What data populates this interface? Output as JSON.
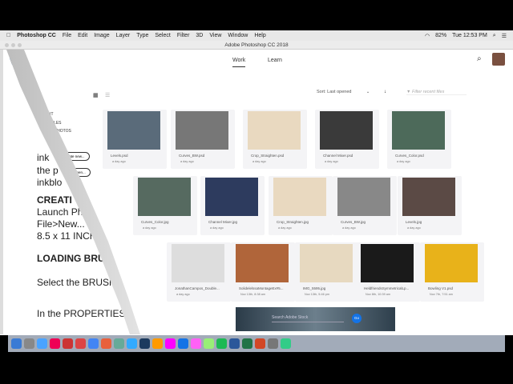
{
  "menubar": {
    "app": "Photoshop CC",
    "items": [
      "File",
      "Edit",
      "Image",
      "Layer",
      "Type",
      "Select",
      "Filter",
      "3D",
      "View",
      "Window",
      "Help"
    ],
    "battery": "82%",
    "clock": "Tue 12:53 PM"
  },
  "window": {
    "title": "Adobe Photoshop CC 2018"
  },
  "document": {
    "lines": [
      "ink",
      "the p",
      "inkblo",
      "CREATI",
      "Launch Pho",
      "File>New...",
      "8.5 x 11 INCH",
      "LOADING BRUS",
      "Select the BRUSH T",
      "In the PROPERTIES M"
    ]
  },
  "ps": {
    "tabs": [
      "Work",
      "Learn"
    ],
    "sort_label": "Sort",
    "sort_value": "Last opened",
    "filter_placeholder": "Filter recent files",
    "sidebar": [
      "RECENT",
      "CC FILES",
      "LR PHOTOS"
    ],
    "create_new": "Create new...",
    "open": "Open...",
    "files": [
      {
        "name": "Levels.psd",
        "date": "a day ago",
        "color": "#5a6b7a"
      },
      {
        "name": "Curves_BW.psd",
        "date": "a day ago",
        "color": "#777"
      },
      {
        "name": "Crop_Straighten.psd",
        "date": "a day ago",
        "color": "#e9d9c0"
      },
      {
        "name": "Channel Mixer.psd",
        "date": "a day ago",
        "color": "#3a3a3a"
      },
      {
        "name": "Curves_Color.psd",
        "date": "a day ago",
        "color": "#4d6a5a"
      },
      {
        "name": "Curves_Color.jpg",
        "date": "a day ago",
        "color": "#566a60"
      },
      {
        "name": "Channel Mixer.jpg",
        "date": "a day ago",
        "color": "#2d3b5e"
      },
      {
        "name": "Crop_Straighten.jpg",
        "date": "a day ago",
        "color": "#e9d9c0"
      },
      {
        "name": "Curves_BW.jpg",
        "date": "a day ago",
        "color": "#888"
      },
      {
        "name": "Levels.jpg",
        "date": "a day ago",
        "color": "#5b4a45"
      },
      {
        "name": "JonathanCampos_Double...",
        "date": "a day ago",
        "color": "#ddd"
      },
      {
        "name": "SolidelelssaMontageEx#5...",
        "date": "Nov 13th, 8:38 am",
        "color": "#b0653a"
      },
      {
        "name": "IMG_5595.jpg",
        "date": "Nov 13th, 5:46 pm",
        "color": "#e7d9c0"
      },
      {
        "name": "HeldfriendsSymmetricalLp...",
        "date": "Nov 8th, 10:39 am",
        "color": "#1a1a1a"
      },
      {
        "name": "Bowling V1.psd",
        "date": "Nov 7th, 7:51 am",
        "color": "#e8b21a"
      }
    ],
    "stock_placeholder": "Search Adobe Stock",
    "stock_go": "Go"
  },
  "dock": {
    "colors": [
      "#3a7bd5",
      "#888",
      "#4aa3ff",
      "#e05",
      "#c33",
      "#d44",
      "#4285f4",
      "#e8603c",
      "#6a9",
      "#3af",
      "#1c3a5e",
      "#ff9a00",
      "#f0f",
      "#1473e6",
      "#ff61f6",
      "#9e7",
      "#1db954",
      "#2b579a",
      "#217346",
      "#d24726",
      "#777",
      "#3c8"
    ]
  }
}
